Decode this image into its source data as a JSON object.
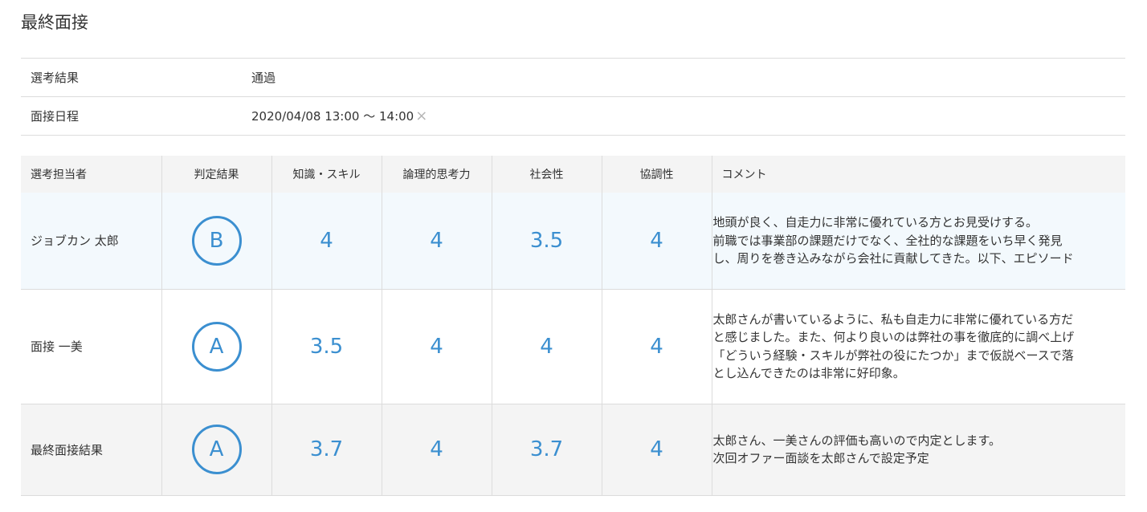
{
  "page_title": "最終面接",
  "info": {
    "result_label": "選考結果",
    "result_value": "通過",
    "schedule_label": "面接日程",
    "schedule_value": "2020/04/08 13:00 〜 14:00",
    "clear_icon": "×"
  },
  "table": {
    "headers": [
      "選考担当者",
      "判定結果",
      "知識・スキル",
      "論理的思考力",
      "社会性",
      "協調性",
      "コメント"
    ],
    "rows": [
      {
        "name": "ジョブカン 太郎",
        "grade": "B",
        "scores": [
          "4",
          "4",
          "3.5",
          "4"
        ],
        "comment_lines": [
          "地頭が良く、自走力に非常に優れている方とお見受けする。",
          "前職では事業部の課題だけでなく、全社的な課題をいち早く発見",
          "し、周りを巻き込みながら会社に貢献してきた。以下、エピソード"
        ]
      },
      {
        "name": "面接 一美",
        "grade": "A",
        "scores": [
          "3.5",
          "4",
          "4",
          "4"
        ],
        "comment_lines": [
          "太郎さんが書いているように、私も自走力に非常に優れている方だ",
          "と感じました。また、何より良いのは弊社の事を徹底的に調べ上げ",
          "「どういう経験・スキルが弊社の役にたつか」まで仮説ベースで落",
          "とし込んできたのは非常に好印象。"
        ]
      },
      {
        "name": "最終面接結果",
        "grade": "A",
        "scores": [
          "3.7",
          "4",
          "3.7",
          "4"
        ],
        "comment_lines": [
          "太郎さん、一美さんの評価も高いので内定とします。",
          "次回オファー面談を太郎さんで設定予定"
        ]
      }
    ]
  },
  "colors": {
    "accent": "#3b8fd0",
    "header_bg": "#f4f4f4",
    "row_highlight": "#f3f9fd",
    "border": "#dcdcdc"
  }
}
